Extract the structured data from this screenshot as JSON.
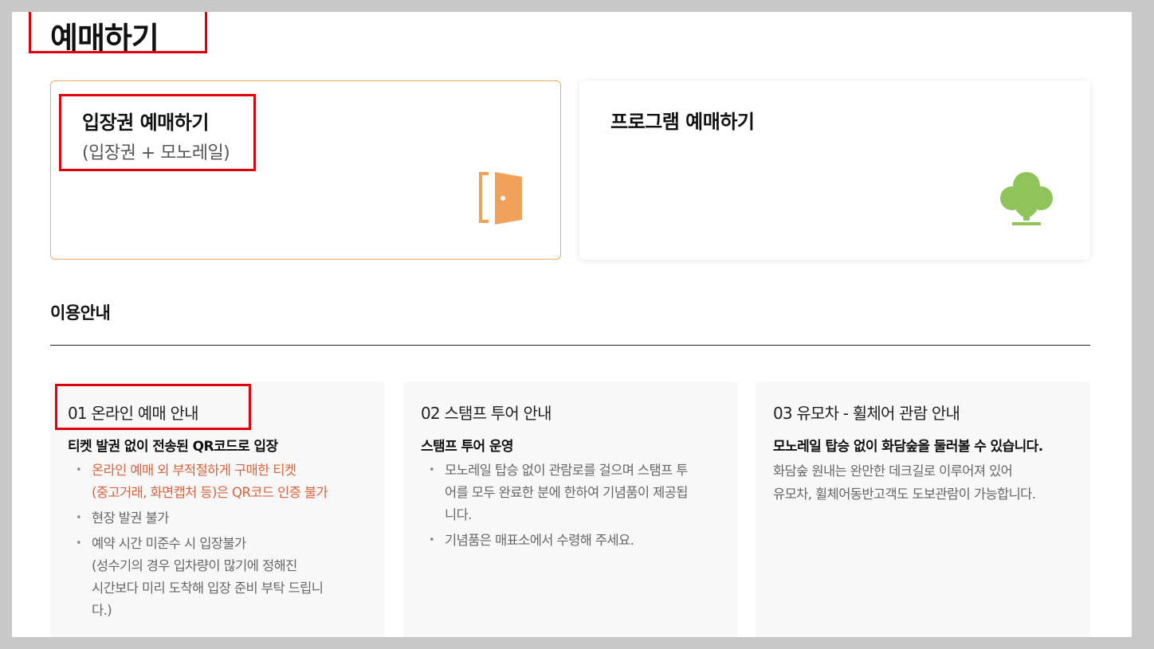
{
  "page": {
    "title": "예매하기"
  },
  "cards": [
    {
      "title": "입장권 예매하기",
      "subtitle": "(입장권 + 모노레일)",
      "icon": "door-icon",
      "icon_color": "#f0a25b"
    },
    {
      "title": "프로그램 예매하기",
      "icon": "tree-icon",
      "icon_color": "#8fc45a"
    }
  ],
  "guide": {
    "title": "이용안내",
    "sections": [
      {
        "heading": "01 온라인 예매 안내",
        "subheading": "티켓 발권 없이 전송된 QR코드로 입장",
        "items": [
          {
            "lines": [
              "온라인 예매 외 부적절하게 구매한 티켓",
              "(중고거래, 화면캡처 등)은 QR코드 인증 불가"
            ],
            "highlight": true
          },
          {
            "lines": [
              "현장 발권 불가"
            ]
          },
          {
            "lines": [
              "예약 시간 미준수 시 입장불가",
              "(성수기의 경우 입차량이 많기에 정해진",
              "시간보다 미리 도착해 입장 준비 부탁 드립니",
              "다.)"
            ]
          }
        ]
      },
      {
        "heading": "02 스탬프 투어 안내",
        "subheading": "스탬프 투어 운영",
        "items": [
          {
            "lines": [
              "모노레일 탑승 없이 관람로를 걸으며 스탬프 투",
              "어를 모두 완료한 분에 한하여 기념품이 제공됩",
              "니다."
            ]
          },
          {
            "lines": [
              "기념품은 매표소에서 수령해 주세요."
            ]
          }
        ]
      },
      {
        "heading": "03 유모차 - 휠체어 관람 안내",
        "subheading": "모노레일 탑승 없이 화담숲을 둘러볼 수 있습니다.",
        "text_lines": [
          "화담숲 원내는 완만한 데크길로 이루어져 있어",
          "유모차, 휠체어동반고객도 도보관람이 가능합니다."
        ]
      }
    ]
  },
  "colors": {
    "highlight": "#e0000b",
    "warning_text": "#d9623b",
    "ticket_border": "#efa96a"
  }
}
